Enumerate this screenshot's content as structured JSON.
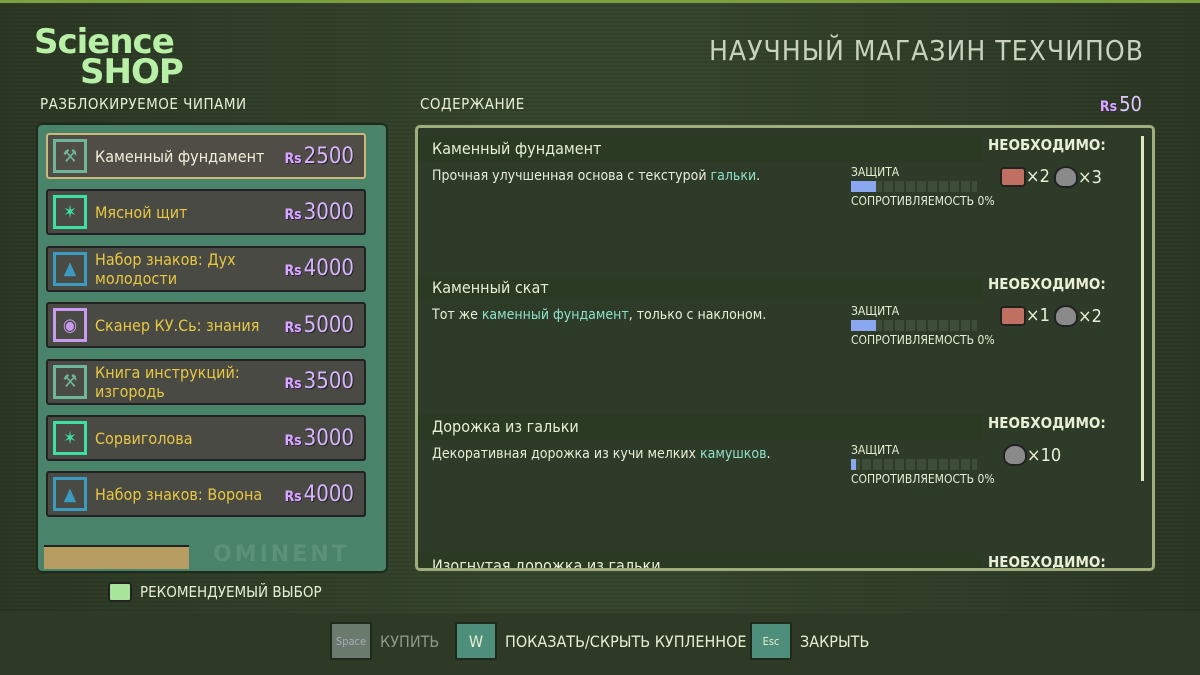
{
  "logo": {
    "line1": "Science",
    "line2": "SHOP"
  },
  "header": {
    "title": "НАУЧНЫЙ МАГАЗИН ТЕХЧИПОВ"
  },
  "left": {
    "label": "РАЗБЛОКИРУЕМОЕ ЧИПАМИ",
    "brand": "OMINENT",
    "items": [
      {
        "name": "Каменный фундамент",
        "price": "2500",
        "icon": "anvil-icon",
        "color": "#6fb59a"
      },
      {
        "name": "Мясной щит",
        "price": "3000",
        "icon": "running-man-icon",
        "color": "#3de0a0"
      },
      {
        "name": "Набор знаков: Дух молодости",
        "price": "4000",
        "icon": "picture-icon",
        "color": "#3a9ac0"
      },
      {
        "name": "Сканер КУ.Сь: знания",
        "price": "5000",
        "icon": "scanner-icon",
        "color": "#c89af0"
      },
      {
        "name": "Книга инструкций: изгородь",
        "price": "3500",
        "icon": "anvil-icon",
        "color": "#6fb59a"
      },
      {
        "name": "Сорвиголова",
        "price": "3000",
        "icon": "running-man-icon",
        "color": "#3de0a0"
      },
      {
        "name": "Набор знаков: Ворона",
        "price": "4000",
        "icon": "picture-icon",
        "color": "#3a9ac0"
      }
    ]
  },
  "recommended": "РЕКОМЕНДУЕМЫЙ ВЫБОР",
  "content": {
    "label": "СОДЕРЖАНИЕ",
    "currency": "Rs",
    "balance": "50",
    "protection_label": "ЗАЩИТА",
    "resistance_label": "СОПРОТИВЛЯЕМОСТЬ",
    "resistance_value": "0%",
    "required_label": "НЕОБХОДИМО:",
    "entries": [
      {
        "title": "Каменный фундамент",
        "desc_pre": "Прочная улучшенная основа с текстурой ",
        "desc_hl": "гальки",
        "desc_post": ".",
        "protection": 0.2,
        "bricks": "×2",
        "stones": "×3"
      },
      {
        "title": "Каменный скат",
        "desc_pre": "Тот же ",
        "desc_hl": "каменный фундамент",
        "desc_post": ", только с наклоном.",
        "protection": 0.2,
        "bricks": "×1",
        "stones": "×2"
      },
      {
        "title": "Дорожка из гальки",
        "desc_pre": "Декоративная дорожка из кучи мелких ",
        "desc_hl": "камушков",
        "desc_post": ".",
        "protection": 0.04,
        "bricks": null,
        "stones": "×10"
      },
      {
        "title": "Изогнутая дорожка из гальки"
      }
    ]
  },
  "footer": {
    "buy_key": "Space",
    "buy": "КУПИТЬ",
    "toggle_key": "W",
    "toggle": "ПОКАЗАТЬ/СКРЫТЬ КУПЛЕННОЕ",
    "close_key": "Esc",
    "close": "ЗАКРЫТЬ"
  }
}
